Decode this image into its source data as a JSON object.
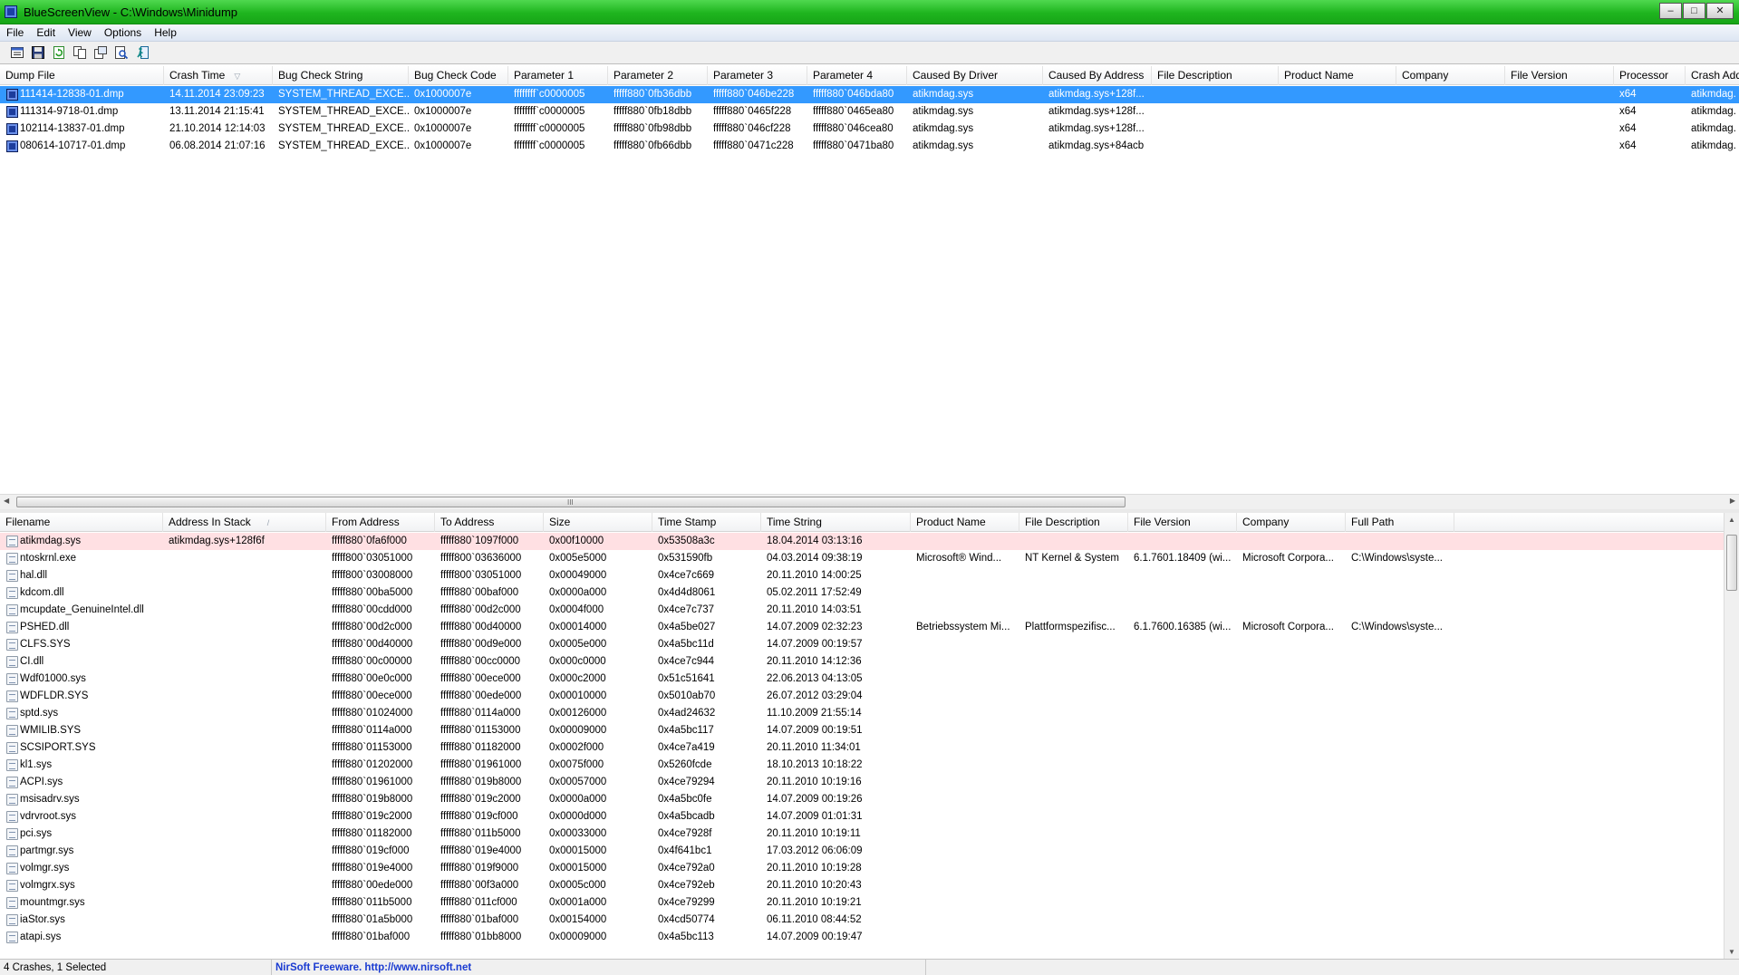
{
  "window": {
    "title": "BlueScreenView  -  C:\\Windows\\Minidump",
    "min": "–",
    "max": "□",
    "close": "✕"
  },
  "menu": [
    "File",
    "Edit",
    "View",
    "Options",
    "Help"
  ],
  "toolbar_icons": [
    "properties-icon",
    "save-icon",
    "refresh-icon",
    "copy-icon",
    "html-report-icon",
    "find-icon",
    "exit-icon"
  ],
  "upper": {
    "sort_mark": "▽",
    "columns": [
      "Dump File",
      "Crash Time",
      "Bug Check String",
      "Bug Check Code",
      "Parameter 1",
      "Parameter 2",
      "Parameter 3",
      "Parameter 4",
      "Caused By Driver",
      "Caused By Address",
      "File Description",
      "Product Name",
      "Company",
      "File Version",
      "Processor",
      "Crash Address"
    ],
    "rows": [
      [
        "111414-12838-01.dmp",
        "14.11.2014 23:09:23",
        "SYSTEM_THREAD_EXCE...",
        "0x1000007e",
        "ffffffff`c0000005",
        "fffff880`0fb36dbb",
        "fffff880`046be228",
        "fffff880`046bda80",
        "atikmdag.sys",
        "atikmdag.sys+128f...",
        "",
        "",
        "",
        "",
        "x64",
        "atikmdag."
      ],
      [
        "111314-9718-01.dmp",
        "13.11.2014 21:15:41",
        "SYSTEM_THREAD_EXCE...",
        "0x1000007e",
        "ffffffff`c0000005",
        "fffff880`0fb18dbb",
        "fffff880`0465f228",
        "fffff880`0465ea80",
        "atikmdag.sys",
        "atikmdag.sys+128f...",
        "",
        "",
        "",
        "",
        "x64",
        "atikmdag."
      ],
      [
        "102114-13837-01.dmp",
        "21.10.2014 12:14:03",
        "SYSTEM_THREAD_EXCE...",
        "0x1000007e",
        "ffffffff`c0000005",
        "fffff880`0fb98dbb",
        "fffff880`046cf228",
        "fffff880`046cea80",
        "atikmdag.sys",
        "atikmdag.sys+128f...",
        "",
        "",
        "",
        "",
        "x64",
        "atikmdag."
      ],
      [
        "080614-10717-01.dmp",
        "06.08.2014 21:07:16",
        "SYSTEM_THREAD_EXCE...",
        "0x1000007e",
        "ffffffff`c0000005",
        "fffff880`0fb66dbb",
        "fffff880`0471c228",
        "fffff880`0471ba80",
        "atikmdag.sys",
        "atikmdag.sys+84acb",
        "",
        "",
        "",
        "",
        "x64",
        "atikmdag."
      ]
    ],
    "selected_row": 0
  },
  "lower": {
    "sort_mark": "/",
    "columns": [
      "Filename",
      "Address In Stack",
      "From Address",
      "To Address",
      "Size",
      "Time Stamp",
      "Time String",
      "Product Name",
      "File Description",
      "File Version",
      "Company",
      "Full Path"
    ],
    "rows": [
      [
        "atikmdag.sys",
        "atikmdag.sys+128f6f",
        "fffff880`0fa6f000",
        "fffff880`1097f000",
        "0x00f10000",
        "0x53508a3c",
        "18.04.2014 03:13:16",
        "",
        "",
        "",
        "",
        ""
      ],
      [
        "ntoskrnl.exe",
        "",
        "fffff800`03051000",
        "fffff800`03636000",
        "0x005e5000",
        "0x531590fb",
        "04.03.2014 09:38:19",
        "Microsoft® Wind...",
        "NT Kernel & System",
        "6.1.7601.18409 (wi...",
        "Microsoft Corpora...",
        "C:\\Windows\\syste..."
      ],
      [
        "hal.dll",
        "",
        "fffff800`03008000",
        "fffff800`03051000",
        "0x00049000",
        "0x4ce7c669",
        "20.11.2010 14:00:25",
        "",
        "",
        "",
        "",
        ""
      ],
      [
        "kdcom.dll",
        "",
        "fffff880`00ba5000",
        "fffff880`00baf000",
        "0x0000a000",
        "0x4d4d8061",
        "05.02.2011 17:52:49",
        "",
        "",
        "",
        "",
        ""
      ],
      [
        "mcupdate_GenuineIntel.dll",
        "",
        "fffff880`00cdd000",
        "fffff880`00d2c000",
        "0x0004f000",
        "0x4ce7c737",
        "20.11.2010 14:03:51",
        "",
        "",
        "",
        "",
        ""
      ],
      [
        "PSHED.dll",
        "",
        "fffff880`00d2c000",
        "fffff880`00d40000",
        "0x00014000",
        "0x4a5be027",
        "14.07.2009 02:32:23",
        "Betriebssystem Mi...",
        "Plattformspezifisc...",
        "6.1.7600.16385 (wi...",
        "Microsoft Corpora...",
        "C:\\Windows\\syste..."
      ],
      [
        "CLFS.SYS",
        "",
        "fffff880`00d40000",
        "fffff880`00d9e000",
        "0x0005e000",
        "0x4a5bc11d",
        "14.07.2009 00:19:57",
        "",
        "",
        "",
        "",
        ""
      ],
      [
        "CI.dll",
        "",
        "fffff880`00c00000",
        "fffff880`00cc0000",
        "0x000c0000",
        "0x4ce7c944",
        "20.11.2010 14:12:36",
        "",
        "",
        "",
        "",
        ""
      ],
      [
        "Wdf01000.sys",
        "",
        "fffff880`00e0c000",
        "fffff880`00ece000",
        "0x000c2000",
        "0x51c51641",
        "22.06.2013 04:13:05",
        "",
        "",
        "",
        "",
        ""
      ],
      [
        "WDFLDR.SYS",
        "",
        "fffff880`00ece000",
        "fffff880`00ede000",
        "0x00010000",
        "0x5010ab70",
        "26.07.2012 03:29:04",
        "",
        "",
        "",
        "",
        ""
      ],
      [
        "sptd.sys",
        "",
        "fffff880`01024000",
        "fffff880`0114a000",
        "0x00126000",
        "0x4ad24632",
        "11.10.2009 21:55:14",
        "",
        "",
        "",
        "",
        ""
      ],
      [
        "WMILIB.SYS",
        "",
        "fffff880`0114a000",
        "fffff880`01153000",
        "0x00009000",
        "0x4a5bc117",
        "14.07.2009 00:19:51",
        "",
        "",
        "",
        "",
        ""
      ],
      [
        "SCSIPORT.SYS",
        "",
        "fffff880`01153000",
        "fffff880`01182000",
        "0x0002f000",
        "0x4ce7a419",
        "20.11.2010 11:34:01",
        "",
        "",
        "",
        "",
        ""
      ],
      [
        "kl1.sys",
        "",
        "fffff880`01202000",
        "fffff880`01961000",
        "0x0075f000",
        "0x5260fcde",
        "18.10.2013 10:18:22",
        "",
        "",
        "",
        "",
        ""
      ],
      [
        "ACPI.sys",
        "",
        "fffff880`01961000",
        "fffff880`019b8000",
        "0x00057000",
        "0x4ce79294",
        "20.11.2010 10:19:16",
        "",
        "",
        "",
        "",
        ""
      ],
      [
        "msisadrv.sys",
        "",
        "fffff880`019b8000",
        "fffff880`019c2000",
        "0x0000a000",
        "0x4a5bc0fe",
        "14.07.2009 00:19:26",
        "",
        "",
        "",
        "",
        ""
      ],
      [
        "vdrvroot.sys",
        "",
        "fffff880`019c2000",
        "fffff880`019cf000",
        "0x0000d000",
        "0x4a5bcadb",
        "14.07.2009 01:01:31",
        "",
        "",
        "",
        "",
        ""
      ],
      [
        "pci.sys",
        "",
        "fffff880`01182000",
        "fffff880`011b5000",
        "0x00033000",
        "0x4ce7928f",
        "20.11.2010 10:19:11",
        "",
        "",
        "",
        "",
        ""
      ],
      [
        "partmgr.sys",
        "",
        "fffff880`019cf000",
        "fffff880`019e4000",
        "0x00015000",
        "0x4f641bc1",
        "17.03.2012 06:06:09",
        "",
        "",
        "",
        "",
        ""
      ],
      [
        "volmgr.sys",
        "",
        "fffff880`019e4000",
        "fffff880`019f9000",
        "0x00015000",
        "0x4ce792a0",
        "20.11.2010 10:19:28",
        "",
        "",
        "",
        "",
        ""
      ],
      [
        "volmgrx.sys",
        "",
        "fffff880`00ede000",
        "fffff880`00f3a000",
        "0x0005c000",
        "0x4ce792eb",
        "20.11.2010 10:20:43",
        "",
        "",
        "",
        "",
        ""
      ],
      [
        "mountmgr.sys",
        "",
        "fffff880`011b5000",
        "fffff880`011cf000",
        "0x0001a000",
        "0x4ce79299",
        "20.11.2010 10:19:21",
        "",
        "",
        "",
        "",
        ""
      ],
      [
        "iaStor.sys",
        "",
        "fffff880`01a5b000",
        "fffff880`01baf000",
        "0x00154000",
        "0x4cd50774",
        "06.11.2010 08:44:52",
        "",
        "",
        "",
        "",
        ""
      ],
      [
        "atapi.sys",
        "",
        "fffff880`01baf000",
        "fffff880`01bb8000",
        "0x00009000",
        "0x4a5bc113",
        "14.07.2009 00:19:47",
        "",
        "",
        "",
        "",
        ""
      ]
    ],
    "highlight_row": 0
  },
  "scroll": {
    "left": "◀",
    "right": "▶",
    "up": "▲",
    "down": "▼",
    "grip": "III"
  },
  "status": {
    "count": "4 Crashes, 1 Selected",
    "credit": "NirSoft Freeware.  http://www.nirsoft.net"
  },
  "colors": {
    "titlebar": "#1fb51f",
    "selection": "#3399ff",
    "highlight": "#ffe0e3",
    "link": "#1a3bd1"
  }
}
